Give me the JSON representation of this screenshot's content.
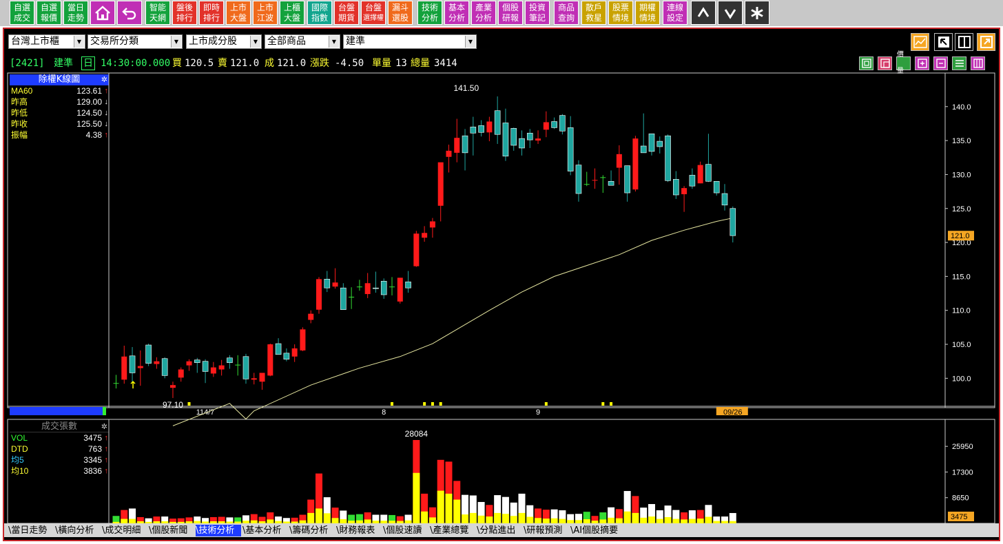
{
  "toolbar": {
    "buttons": [
      {
        "l1": "自選",
        "l2": "成交",
        "color": "#13a23c"
      },
      {
        "l1": "自選",
        "l2": "報價",
        "color": "#13a23c"
      },
      {
        "l1": "當日",
        "l2": "走勢",
        "color": "#13a23c"
      },
      {
        "l1": "智能",
        "l2": "天網",
        "color": "#13a23c"
      },
      {
        "l1": "盤後",
        "l2": "排行",
        "color": "#e2322a"
      },
      {
        "l1": "即時",
        "l2": "排行",
        "color": "#e2322a"
      },
      {
        "l1": "上市",
        "l2": "大盤",
        "color": "#f06a1c"
      },
      {
        "l1": "上市",
        "l2": "江波",
        "color": "#f06a1c"
      },
      {
        "l1": "上櫃",
        "l2": "大盤",
        "color": "#13a23c"
      },
      {
        "l1": "國際",
        "l2": "指數",
        "color": "#12a58e"
      },
      {
        "l1": "台盤",
        "l2": "期貨",
        "color": "#e2322a"
      },
      {
        "l1": "台盤",
        "l2": "選擇權",
        "color": "#e2322a"
      },
      {
        "l1": "漏斗",
        "l2": "選股",
        "color": "#f06a1c"
      },
      {
        "l1": "技術",
        "l2": "分析",
        "color": "#13a23c"
      },
      {
        "l1": "基本",
        "l2": "分析",
        "color": "#c02fb5"
      },
      {
        "l1": "產業",
        "l2": "分析",
        "color": "#c02fb5"
      },
      {
        "l1": "個股",
        "l2": "研報",
        "color": "#c02fb5"
      },
      {
        "l1": "投資",
        "l2": "筆記",
        "color": "#c02fb5"
      },
      {
        "l1": "商品",
        "l2": "查詢",
        "color": "#c02fb5"
      },
      {
        "l1": "散戶",
        "l2": "救星",
        "color": "#c9a200"
      },
      {
        "l1": "股票",
        "l2": "情境",
        "color": "#c9a200"
      },
      {
        "l1": "期權",
        "l2": "情境",
        "color": "#c9a200"
      },
      {
        "l1": "連線",
        "l2": "設定",
        "color": "#c02fb5"
      }
    ]
  },
  "selectors": {
    "market": "台灣上市櫃",
    "category": "交易所分類",
    "group": "上市成分股",
    "products": "全部商品",
    "stock": "建準"
  },
  "quote": {
    "code": "[2421]",
    "name": "建準",
    "period": "日",
    "time": "14:30:00.000",
    "bid_label": "買",
    "bid": "120.5",
    "ask_label": "賣",
    "ask": "121.0",
    "deal_label": "成",
    "deal": "121.0",
    "change_label": "漲跌",
    "change": "-4.50",
    "unit_vol_label": "單量",
    "unit_vol": "13",
    "total_vol_label": "總量",
    "total_vol": "3414"
  },
  "kpanel": {
    "title": "除權K線圖",
    "rows": [
      {
        "label": "MA60",
        "value": "123.61",
        "arrow": "↑",
        "lcolor": "#ffff33",
        "acolor": "#ff3030"
      },
      {
        "label": "昨高",
        "value": "129.00",
        "arrow": "↓",
        "lcolor": "#ffff33",
        "acolor": "#ffffff"
      },
      {
        "label": "昨低",
        "value": "124.50",
        "arrow": "↓",
        "lcolor": "#ffff33",
        "acolor": "#ffffff"
      },
      {
        "label": "昨收",
        "value": "125.50",
        "arrow": "↓",
        "lcolor": "#ffff33",
        "acolor": "#ffffff"
      },
      {
        "label": "振幅",
        "value": "4.38",
        "arrow": "↑",
        "lcolor": "#ffff33",
        "acolor": "#ff3030"
      }
    ]
  },
  "vpanel": {
    "title": "成交張數",
    "rows": [
      {
        "label": "VOL",
        "value": "3475",
        "arrow": "↑",
        "lcolor": "#33ff33",
        "acolor": "#ff3030"
      },
      {
        "label": "DTD",
        "value": "763",
        "arrow": "↑",
        "lcolor": "#ffff33",
        "acolor": "#ff3030"
      },
      {
        "label": "均5",
        "value": "3345",
        "arrow": "↑",
        "lcolor": "#33ccff",
        "acolor": "#ff3030"
      },
      {
        "label": "均10",
        "value": "3836",
        "arrow": "↑",
        "lcolor": "#ffff33",
        "acolor": "#ff3030"
      }
    ]
  },
  "chart_data": [
    {
      "type": "candlestick",
      "title": "除權K線圖",
      "ylim": [
        95,
        143
      ],
      "yticks": [
        100,
        105,
        110,
        115,
        120,
        125,
        130,
        135,
        140
      ],
      "ytick_labels": [
        "100.0",
        "105.0",
        "110.0",
        "115.0",
        "120.0",
        "125.0",
        "130.0",
        "135.0",
        "140.0"
      ],
      "current_price_label": "121.0",
      "current_price": 121.0,
      "x_labels": [
        {
          "index": 11,
          "text": "114/7"
        },
        {
          "index": 33,
          "text": "8"
        },
        {
          "index": 52,
          "text": "9"
        }
      ],
      "last_date_label": "09/26",
      "high_annotation": {
        "index": 44,
        "text": "141.50"
      },
      "low_annotation": {
        "index": 7,
        "text": "97.10"
      },
      "colors": {
        "up": "#ff1a1a",
        "down": "#1fa6a0",
        "flat": "#33dd33",
        "ma": "#e6e6a0"
      },
      "ma60_label": "MA60",
      "candles": [
        {
          "o": 99.3,
          "h": 100.5,
          "l": 98.5,
          "c": 99.3
        },
        {
          "o": 99.8,
          "h": 104.8,
          "l": 99.2,
          "c": 103.2
        },
        {
          "o": 103.3,
          "h": 104.6,
          "l": 99.4,
          "c": 100.8
        },
        {
          "o": 101.5,
          "h": 104.1,
          "l": 98.9,
          "c": 101.8
        },
        {
          "o": 104.9,
          "h": 105.1,
          "l": 101.8,
          "c": 102.2
        },
        {
          "o": 102.1,
          "h": 103.1,
          "l": 101.4,
          "c": 102.5
        },
        {
          "o": 102.9,
          "h": 103.1,
          "l": 100.0,
          "c": 100.4
        },
        {
          "o": 98.6,
          "h": 99.5,
          "l": 97.1,
          "c": 99.0
        },
        {
          "o": 100.1,
          "h": 101.6,
          "l": 99.5,
          "c": 101.3
        },
        {
          "o": 101.9,
          "h": 102.8,
          "l": 101.1,
          "c": 102.5
        },
        {
          "o": 102.7,
          "h": 103.0,
          "l": 100.8,
          "c": 102.3
        },
        {
          "o": 102.5,
          "h": 102.8,
          "l": 99.3,
          "c": 101.0
        },
        {
          "o": 100.7,
          "h": 102.4,
          "l": 100.2,
          "c": 101.6
        },
        {
          "o": 101.3,
          "h": 102.7,
          "l": 100.4,
          "c": 101.9
        },
        {
          "o": 103.0,
          "h": 103.4,
          "l": 101.4,
          "c": 102.3
        },
        {
          "o": 102.0,
          "h": 103.4,
          "l": 100.4,
          "c": 102.0
        },
        {
          "o": 103.2,
          "h": 103.6,
          "l": 99.2,
          "c": 99.9
        },
        {
          "o": 99.8,
          "h": 100.8,
          "l": 99.1,
          "c": 100.0
        },
        {
          "o": 99.5,
          "h": 100.5,
          "l": 98.3,
          "c": 100.8
        },
        {
          "o": 100.4,
          "h": 105.1,
          "l": 100.3,
          "c": 105.0
        },
        {
          "o": 105.1,
          "h": 105.9,
          "l": 104.3,
          "c": 103.5
        },
        {
          "o": 103.7,
          "h": 104.4,
          "l": 102.5,
          "c": 102.8
        },
        {
          "o": 103.2,
          "h": 105.0,
          "l": 102.4,
          "c": 104.4
        },
        {
          "o": 104.1,
          "h": 107.5,
          "l": 104.0,
          "c": 107.2
        },
        {
          "o": 108.6,
          "h": 110.0,
          "l": 108.1,
          "c": 109.5
        },
        {
          "o": 110.1,
          "h": 114.9,
          "l": 109.5,
          "c": 114.6
        },
        {
          "o": 114.6,
          "h": 115.8,
          "l": 112.7,
          "c": 113.3
        },
        {
          "o": 113.5,
          "h": 116.2,
          "l": 113.2,
          "c": 114.1
        },
        {
          "o": 113.3,
          "h": 114.0,
          "l": 110.1,
          "c": 110.1
        },
        {
          "o": 112.0,
          "h": 113.4,
          "l": 110.2,
          "c": 112.0
        },
        {
          "o": 113.5,
          "h": 114.5,
          "l": 112.9,
          "c": 113.5
        },
        {
          "o": 112.4,
          "h": 115.5,
          "l": 111.8,
          "c": 114.0
        },
        {
          "o": 113.3,
          "h": 115.7,
          "l": 112.6,
          "c": 113.2
        },
        {
          "o": 114.3,
          "h": 114.7,
          "l": 111.7,
          "c": 112.3
        },
        {
          "o": 113.5,
          "h": 114.9,
          "l": 112.2,
          "c": 113.5
        },
        {
          "o": 111.3,
          "h": 114.8,
          "l": 111.0,
          "c": 114.8
        },
        {
          "o": 114.2,
          "h": 115.8,
          "l": 112.6,
          "c": 113.3
        },
        {
          "o": 116.5,
          "h": 121.7,
          "l": 116.4,
          "c": 121.3
        },
        {
          "o": 120.7,
          "h": 122.4,
          "l": 120.1,
          "c": 121.4
        },
        {
          "o": 122.2,
          "h": 123.6,
          "l": 120.7,
          "c": 123.1
        },
        {
          "o": 125.4,
          "h": 131.2,
          "l": 123.1,
          "c": 131.8
        },
        {
          "o": 132.6,
          "h": 134.4,
          "l": 130.3,
          "c": 133.5
        },
        {
          "o": 133.2,
          "h": 138.2,
          "l": 131.8,
          "c": 135.4
        },
        {
          "o": 135.7,
          "h": 136.7,
          "l": 130.6,
          "c": 133.2
        },
        {
          "o": 137.0,
          "h": 138.5,
          "l": 132.8,
          "c": 136.1
        },
        {
          "o": 137.2,
          "h": 138.0,
          "l": 135.6,
          "c": 136.2
        },
        {
          "o": 136.2,
          "h": 138.5,
          "l": 134.9,
          "c": 137.8
        },
        {
          "o": 139.4,
          "h": 141.5,
          "l": 134.5,
          "c": 135.9
        },
        {
          "o": 137.6,
          "h": 139.7,
          "l": 132.0,
          "c": 132.7
        },
        {
          "o": 136.8,
          "h": 136.9,
          "l": 133.5,
          "c": 134.3
        },
        {
          "o": 135.3,
          "h": 136.5,
          "l": 132.8,
          "c": 133.9
        },
        {
          "o": 136.1,
          "h": 136.7,
          "l": 133.9,
          "c": 135.1
        },
        {
          "o": 135.0,
          "h": 136.5,
          "l": 134.5,
          "c": 135.3
        },
        {
          "o": 136.6,
          "h": 139.3,
          "l": 135.5,
          "c": 137.7
        },
        {
          "o": 137.8,
          "h": 138.4,
          "l": 136.7,
          "c": 136.9
        },
        {
          "o": 138.7,
          "h": 138.9,
          "l": 135.9,
          "c": 136.4
        },
        {
          "o": 136.9,
          "h": 138.6,
          "l": 129.9,
          "c": 130.5
        },
        {
          "o": 131.4,
          "h": 132.1,
          "l": 126.0,
          "c": 127.2
        },
        {
          "o": 128.6,
          "h": 130.4,
          "l": 128.3,
          "c": 128.6
        },
        {
          "o": 129.1,
          "h": 130.9,
          "l": 127.9,
          "c": 129.2
        },
        {
          "o": 129.6,
          "h": 129.9,
          "l": 127.3,
          "c": 129.6
        },
        {
          "o": 129.0,
          "h": 130.6,
          "l": 128.5,
          "c": 128.4
        },
        {
          "o": 131.0,
          "h": 134.3,
          "l": 128.5,
          "c": 133.0
        },
        {
          "o": 131.3,
          "h": 131.3,
          "l": 126.0,
          "c": 127.3
        },
        {
          "o": 127.8,
          "h": 135.7,
          "l": 127.5,
          "c": 135.3
        },
        {
          "o": 134.2,
          "h": 139.0,
          "l": 133.7,
          "c": 133.2
        },
        {
          "o": 136.0,
          "h": 136.0,
          "l": 132.8,
          "c": 133.4
        },
        {
          "o": 134.9,
          "h": 135.6,
          "l": 133.1,
          "c": 134.1
        },
        {
          "o": 135.7,
          "h": 135.9,
          "l": 128.9,
          "c": 129.1
        },
        {
          "o": 129.3,
          "h": 130.5,
          "l": 126.4,
          "c": 127.0
        },
        {
          "o": 127.1,
          "h": 128.3,
          "l": 124.5,
          "c": 128.0
        },
        {
          "o": 129.9,
          "h": 130.9,
          "l": 127.9,
          "c": 128.3
        },
        {
          "o": 128.7,
          "h": 131.9,
          "l": 128.7,
          "c": 131.4
        },
        {
          "o": 131.5,
          "h": 136.0,
          "l": 128.9,
          "c": 129.0
        },
        {
          "o": 129.0,
          "h": 129.0,
          "l": 126.9,
          "c": 127.3
        },
        {
          "o": 127.2,
          "h": 128.6,
          "l": 124.7,
          "c": 125.5
        },
        {
          "o": 125.0,
          "h": 125.3,
          "l": 120.0,
          "c": 121.0
        }
      ],
      "ma60": [
        {
          "i": 7,
          "v": 93.0
        },
        {
          "i": 14,
          "v": 96.3
        },
        {
          "i": 16,
          "v": 94.0
        },
        {
          "i": 17,
          "v": 95.2
        },
        {
          "i": 24,
          "v": 99.0
        },
        {
          "i": 30,
          "v": 101.5
        },
        {
          "i": 35,
          "v": 103.2
        },
        {
          "i": 39,
          "v": 105.1
        },
        {
          "i": 42,
          "v": 107.2
        },
        {
          "i": 46,
          "v": 110.0
        },
        {
          "i": 50,
          "v": 112.7
        },
        {
          "i": 54,
          "v": 115.0
        },
        {
          "i": 58,
          "v": 116.6
        },
        {
          "i": 62,
          "v": 118.2
        },
        {
          "i": 66,
          "v": 120.3
        },
        {
          "i": 70,
          "v": 121.8
        },
        {
          "i": 74,
          "v": 123.1
        },
        {
          "i": 76,
          "v": 123.6
        }
      ],
      "markers": [
        {
          "i": 9
        },
        {
          "i": 34
        },
        {
          "i": 38
        },
        {
          "i": 39
        },
        {
          "i": 40
        },
        {
          "i": 53
        },
        {
          "i": 60
        },
        {
          "i": 61
        }
      ]
    },
    {
      "type": "bar",
      "title": "成交張數",
      "ylim": [
        0,
        30000
      ],
      "yticks": [
        8650,
        17300,
        25950
      ],
      "ytick_labels": [
        "8650",
        "17300",
        "25950"
      ],
      "current_volume_label": "3475",
      "max_annotation": {
        "index": 37,
        "text": "28084"
      },
      "note": "bar color follows candle direction; yellow = day-trade (DTD) portion",
      "values": [
        2500,
        4500,
        5000,
        2100,
        1700,
        2300,
        2300,
        1600,
        1700,
        2000,
        2300,
        1800,
        2100,
        2200,
        2000,
        2000,
        2700,
        3100,
        2200,
        3700,
        2300,
        1800,
        1900,
        2900,
        8000,
        16800,
        8800,
        5300,
        4300,
        2900,
        3100,
        3700,
        2900,
        2900,
        2800,
        2400,
        2900,
        28084,
        10000,
        5400,
        21400,
        20800,
        14300,
        9600,
        9400,
        7200,
        6200,
        9500,
        8900,
        7000,
        10000,
        6100,
        5000,
        4600,
        4700,
        4400,
        3100,
        3200,
        3900,
        2500,
        3700,
        5400,
        4800,
        10900,
        9200,
        5300,
        6500,
        4400,
        6000,
        4500,
        3700,
        4400,
        4500,
        6200,
        2300,
        2300,
        3475
      ],
      "dtd": [
        500,
        1500,
        1500,
        700,
        500,
        700,
        700,
        500,
        500,
        700,
        800,
        600,
        700,
        700,
        600,
        600,
        900,
        1000,
        700,
        1300,
        800,
        600,
        600,
        1000,
        3500,
        5000,
        3400,
        1800,
        1400,
        900,
        1000,
        1300,
        900,
        900,
        900,
        800,
        1000,
        17000,
        4000,
        2000,
        11000,
        10000,
        8000,
        3000,
        3500,
        2600,
        2300,
        3500,
        3200,
        2500,
        3500,
        2200,
        1800,
        1600,
        1700,
        1500,
        1100,
        1100,
        1400,
        900,
        1300,
        1900,
        1700,
        4000,
        3500,
        1900,
        2300,
        1500,
        2100,
        1500,
        1300,
        1500,
        1600,
        2200,
        800,
        800,
        763
      ]
    }
  ],
  "tabs": [
    "當日走勢",
    "橫向分析",
    "成交明細",
    "個股新聞",
    "技術分析",
    "基本分析",
    "籌碼分析",
    "財務報表",
    "個股速讀",
    "產業總覽",
    "分點進出",
    "研報預測",
    "AI個股摘要"
  ],
  "active_tab": "技術分析"
}
